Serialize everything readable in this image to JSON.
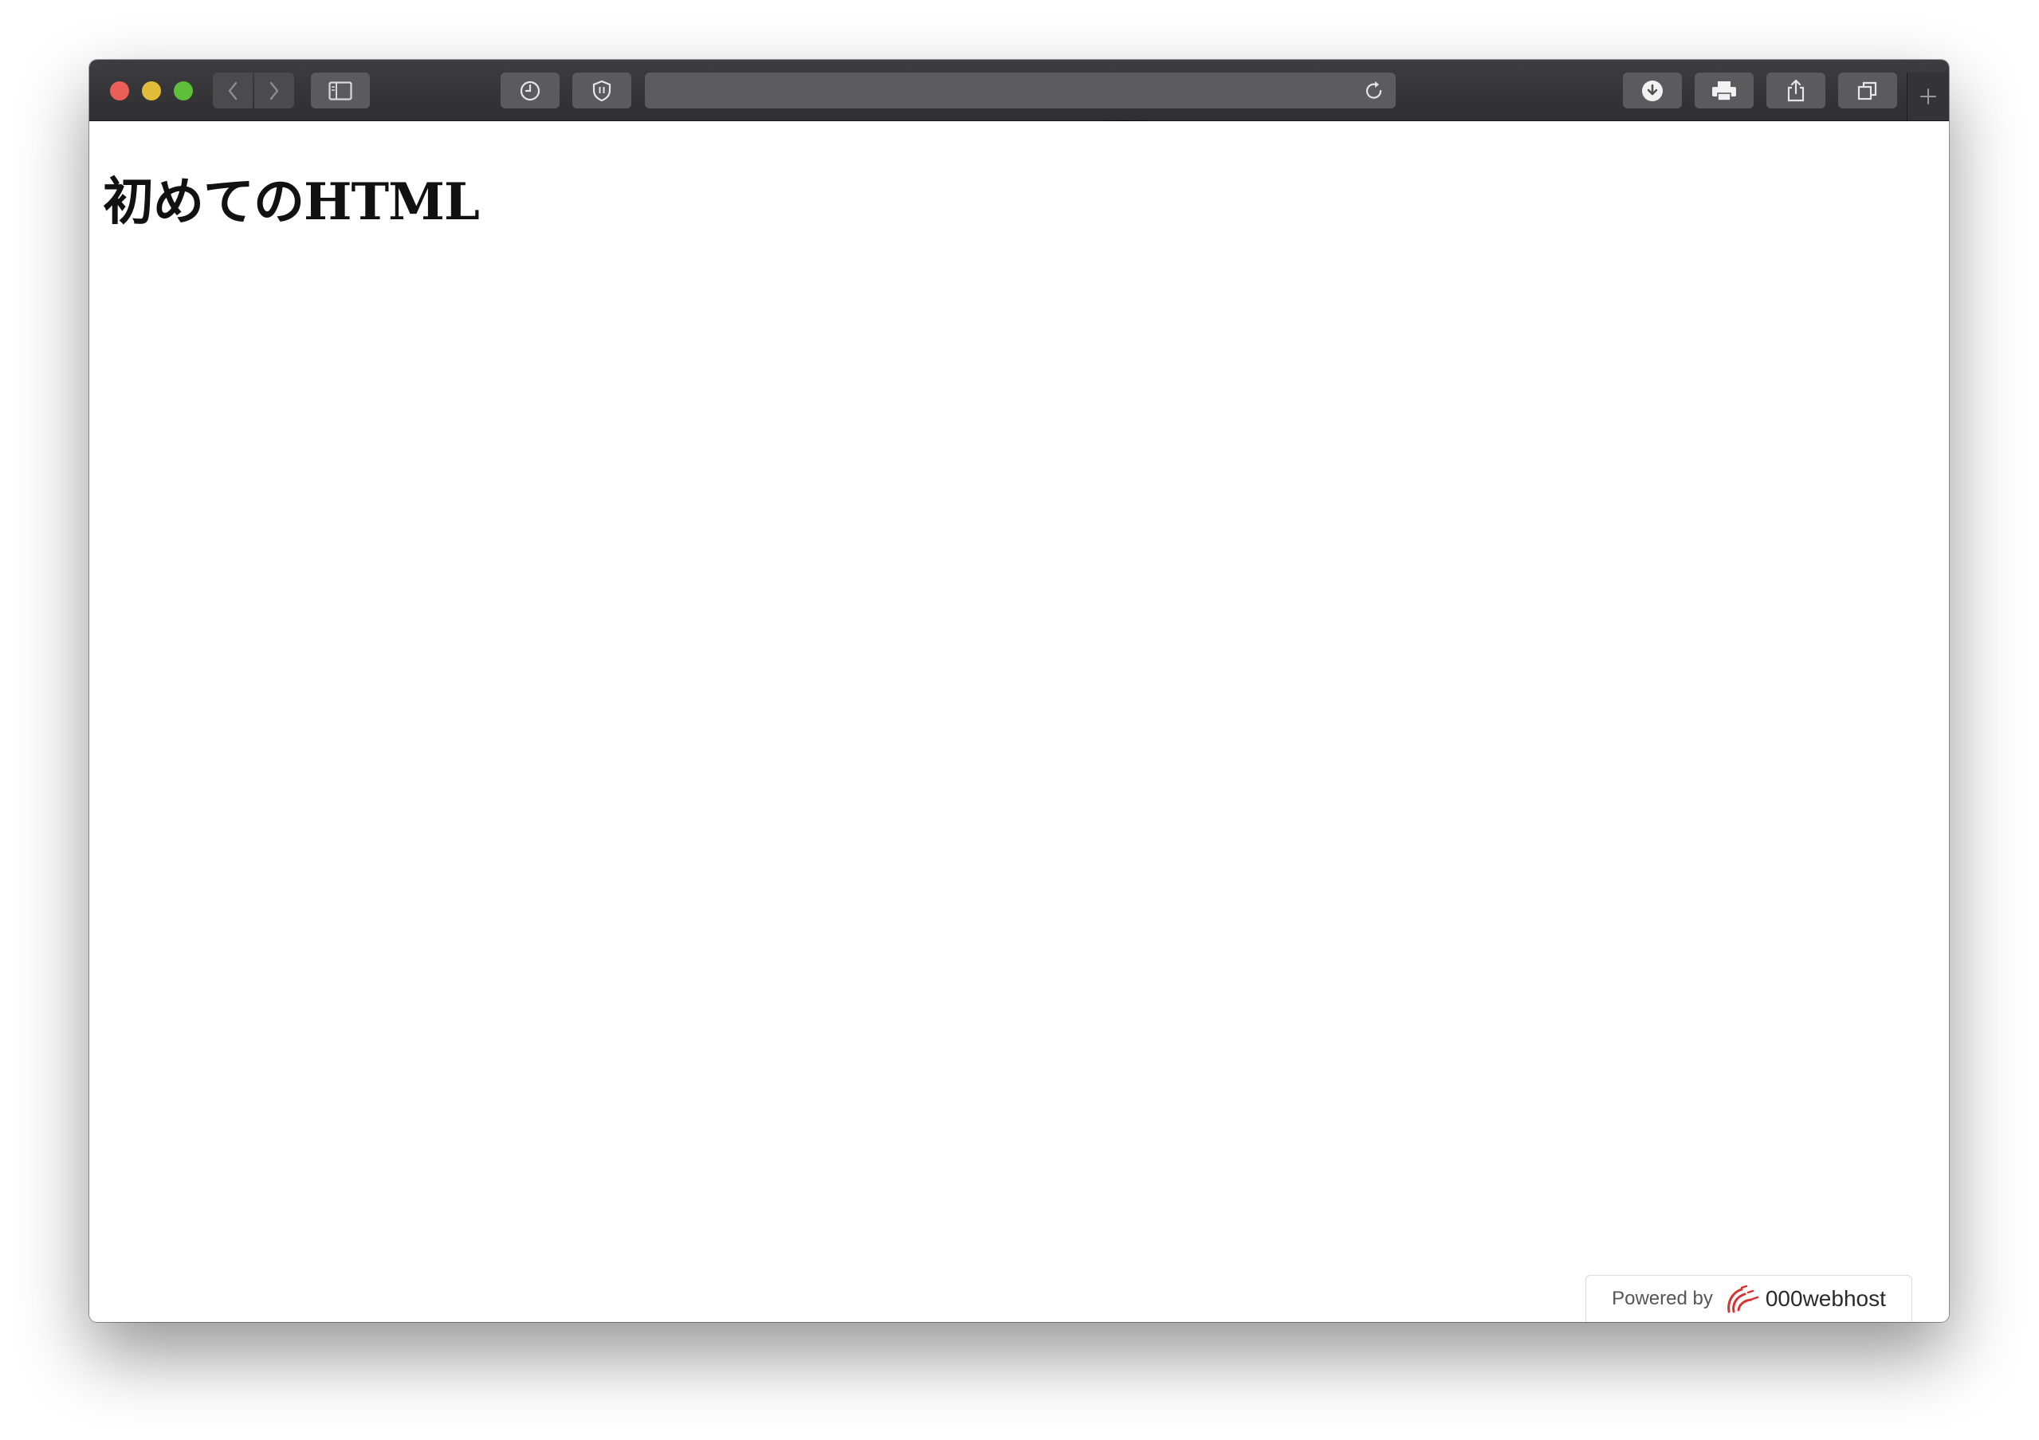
{
  "browser": {
    "toolbar": {
      "buttons": {
        "back": "chevron-left-icon",
        "forward": "chevron-right-icon",
        "sidebar": "sidebar-icon",
        "history": "clock-icon",
        "extension": "shield-icon",
        "reload": "reload-icon",
        "download": "download-icon",
        "print": "printer-icon",
        "share": "share-icon",
        "tabs": "tabs-overview-icon",
        "new_tab": "plus-icon"
      },
      "url": ""
    }
  },
  "page": {
    "heading": "初めてのHTML"
  },
  "footer_badge": {
    "powered_by": "Powered by",
    "brand": "000webhost",
    "brand_color": "#d6322f"
  }
}
